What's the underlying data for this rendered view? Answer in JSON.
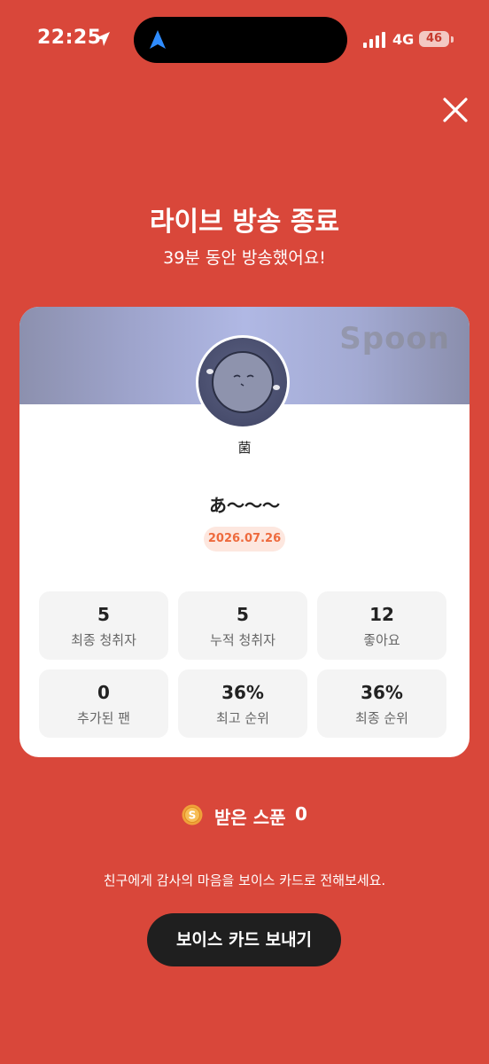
{
  "status_bar": {
    "time": "22:25",
    "network": "4G",
    "battery": "46",
    "icons": [
      "location-arrow-icon",
      "navigation-icon",
      "signal-icon"
    ]
  },
  "header": {
    "title": "라이브 방송 종료",
    "subtitle": "39분 동안 방송했어요!"
  },
  "card": {
    "brand": "Spoon",
    "username": "菌",
    "broadcast_title": "あ〜〜〜",
    "date": "2026.07.26",
    "stats": [
      {
        "value": "5",
        "label": "최종 청취자"
      },
      {
        "value": "5",
        "label": "누적 청취자"
      },
      {
        "value": "12",
        "label": "좋아요"
      },
      {
        "value": "0",
        "label": "추가된 팬"
      },
      {
        "value": "36%",
        "label": "최고 순위"
      },
      {
        "value": "36%",
        "label": "최종 순위"
      }
    ]
  },
  "spoon": {
    "label": "받은 스푼",
    "count": "0",
    "icon": "coin-icon"
  },
  "footer": {
    "message": "친구에게 감사의 마음을 보이스 카드로 전해보세요.",
    "button_label": "보이스 카드 보내기"
  },
  "colors": {
    "background": "#D9473A",
    "card": "#FFFFFF",
    "date_accent": "#EE6A3D",
    "button": "#1F1F1F"
  }
}
